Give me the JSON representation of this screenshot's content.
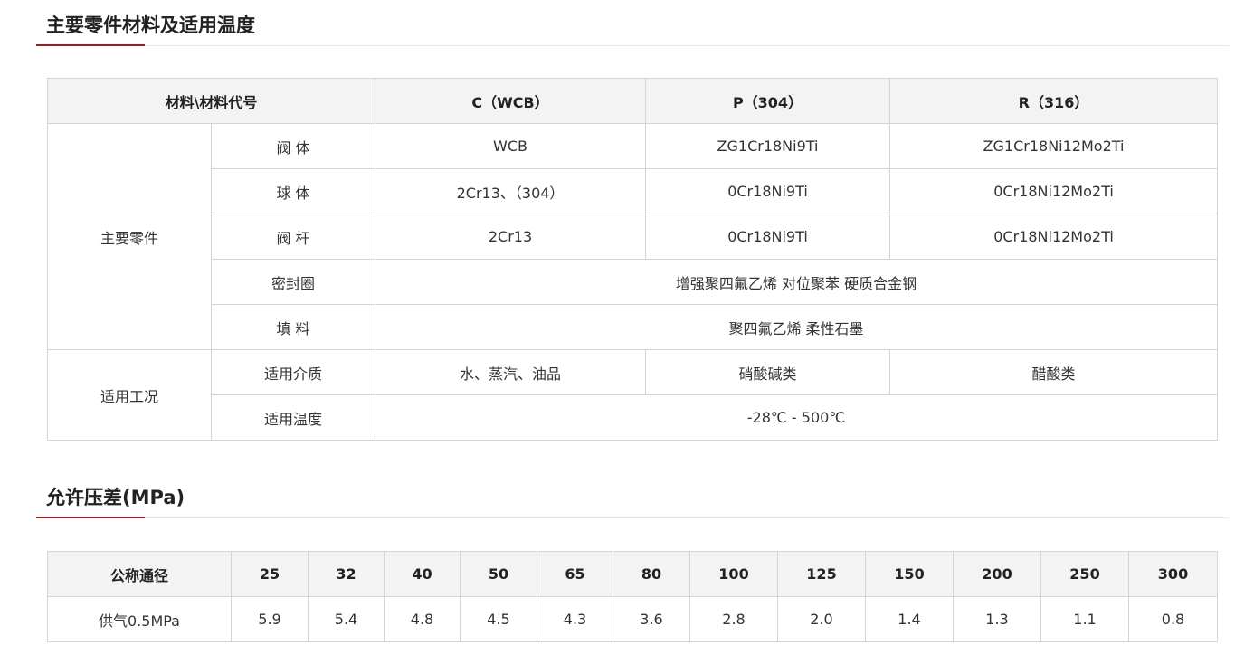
{
  "section1": {
    "title": "主要零件材料及适用温度",
    "header": [
      "材料\\材料代号",
      "C（WCB）",
      "P（304）",
      "R（316）"
    ],
    "group_main": "主要零件",
    "group_work": "适用工况",
    "rows": [
      {
        "part": "阀 体",
        "c": "WCB",
        "p": "ZG1Cr18Ni9Ti",
        "r": "ZG1Cr18Ni12Mo2Ti"
      },
      {
        "part": "球 体",
        "c": "2Cr13、（304）",
        "p": "0Cr18Ni9Ti",
        "r": "0Cr18Ni12Mo2Ti"
      },
      {
        "part": "阀 杆",
        "c": "2Cr13",
        "p": "0Cr18Ni9Ti",
        "r": "0Cr18Ni12Mo2Ti"
      },
      {
        "part": "密封圈",
        "all": "增强聚四氟乙烯 对位聚苯 硬质合金钢"
      },
      {
        "part": "填 料",
        "all": "聚四氟乙烯 柔性石墨"
      },
      {
        "part": "适用介质",
        "c": "水、蒸汽、油品",
        "p": "硝酸碱类",
        "r": "醋酸类"
      },
      {
        "part": "适用温度",
        "all": "-28℃ - 500℃"
      }
    ]
  },
  "section2": {
    "title": "允许压差(MPa)",
    "header_label": "公称通径",
    "sizes": [
      "25",
      "32",
      "40",
      "50",
      "65",
      "80",
      "100",
      "125",
      "150",
      "200",
      "250",
      "300"
    ],
    "row_label": "供气0.5MPa",
    "values": [
      "5.9",
      "5.4",
      "4.8",
      "4.5",
      "4.3",
      "3.6",
      "2.8",
      "2.0",
      "1.4",
      "1.3",
      "1.1",
      "0.8"
    ]
  }
}
